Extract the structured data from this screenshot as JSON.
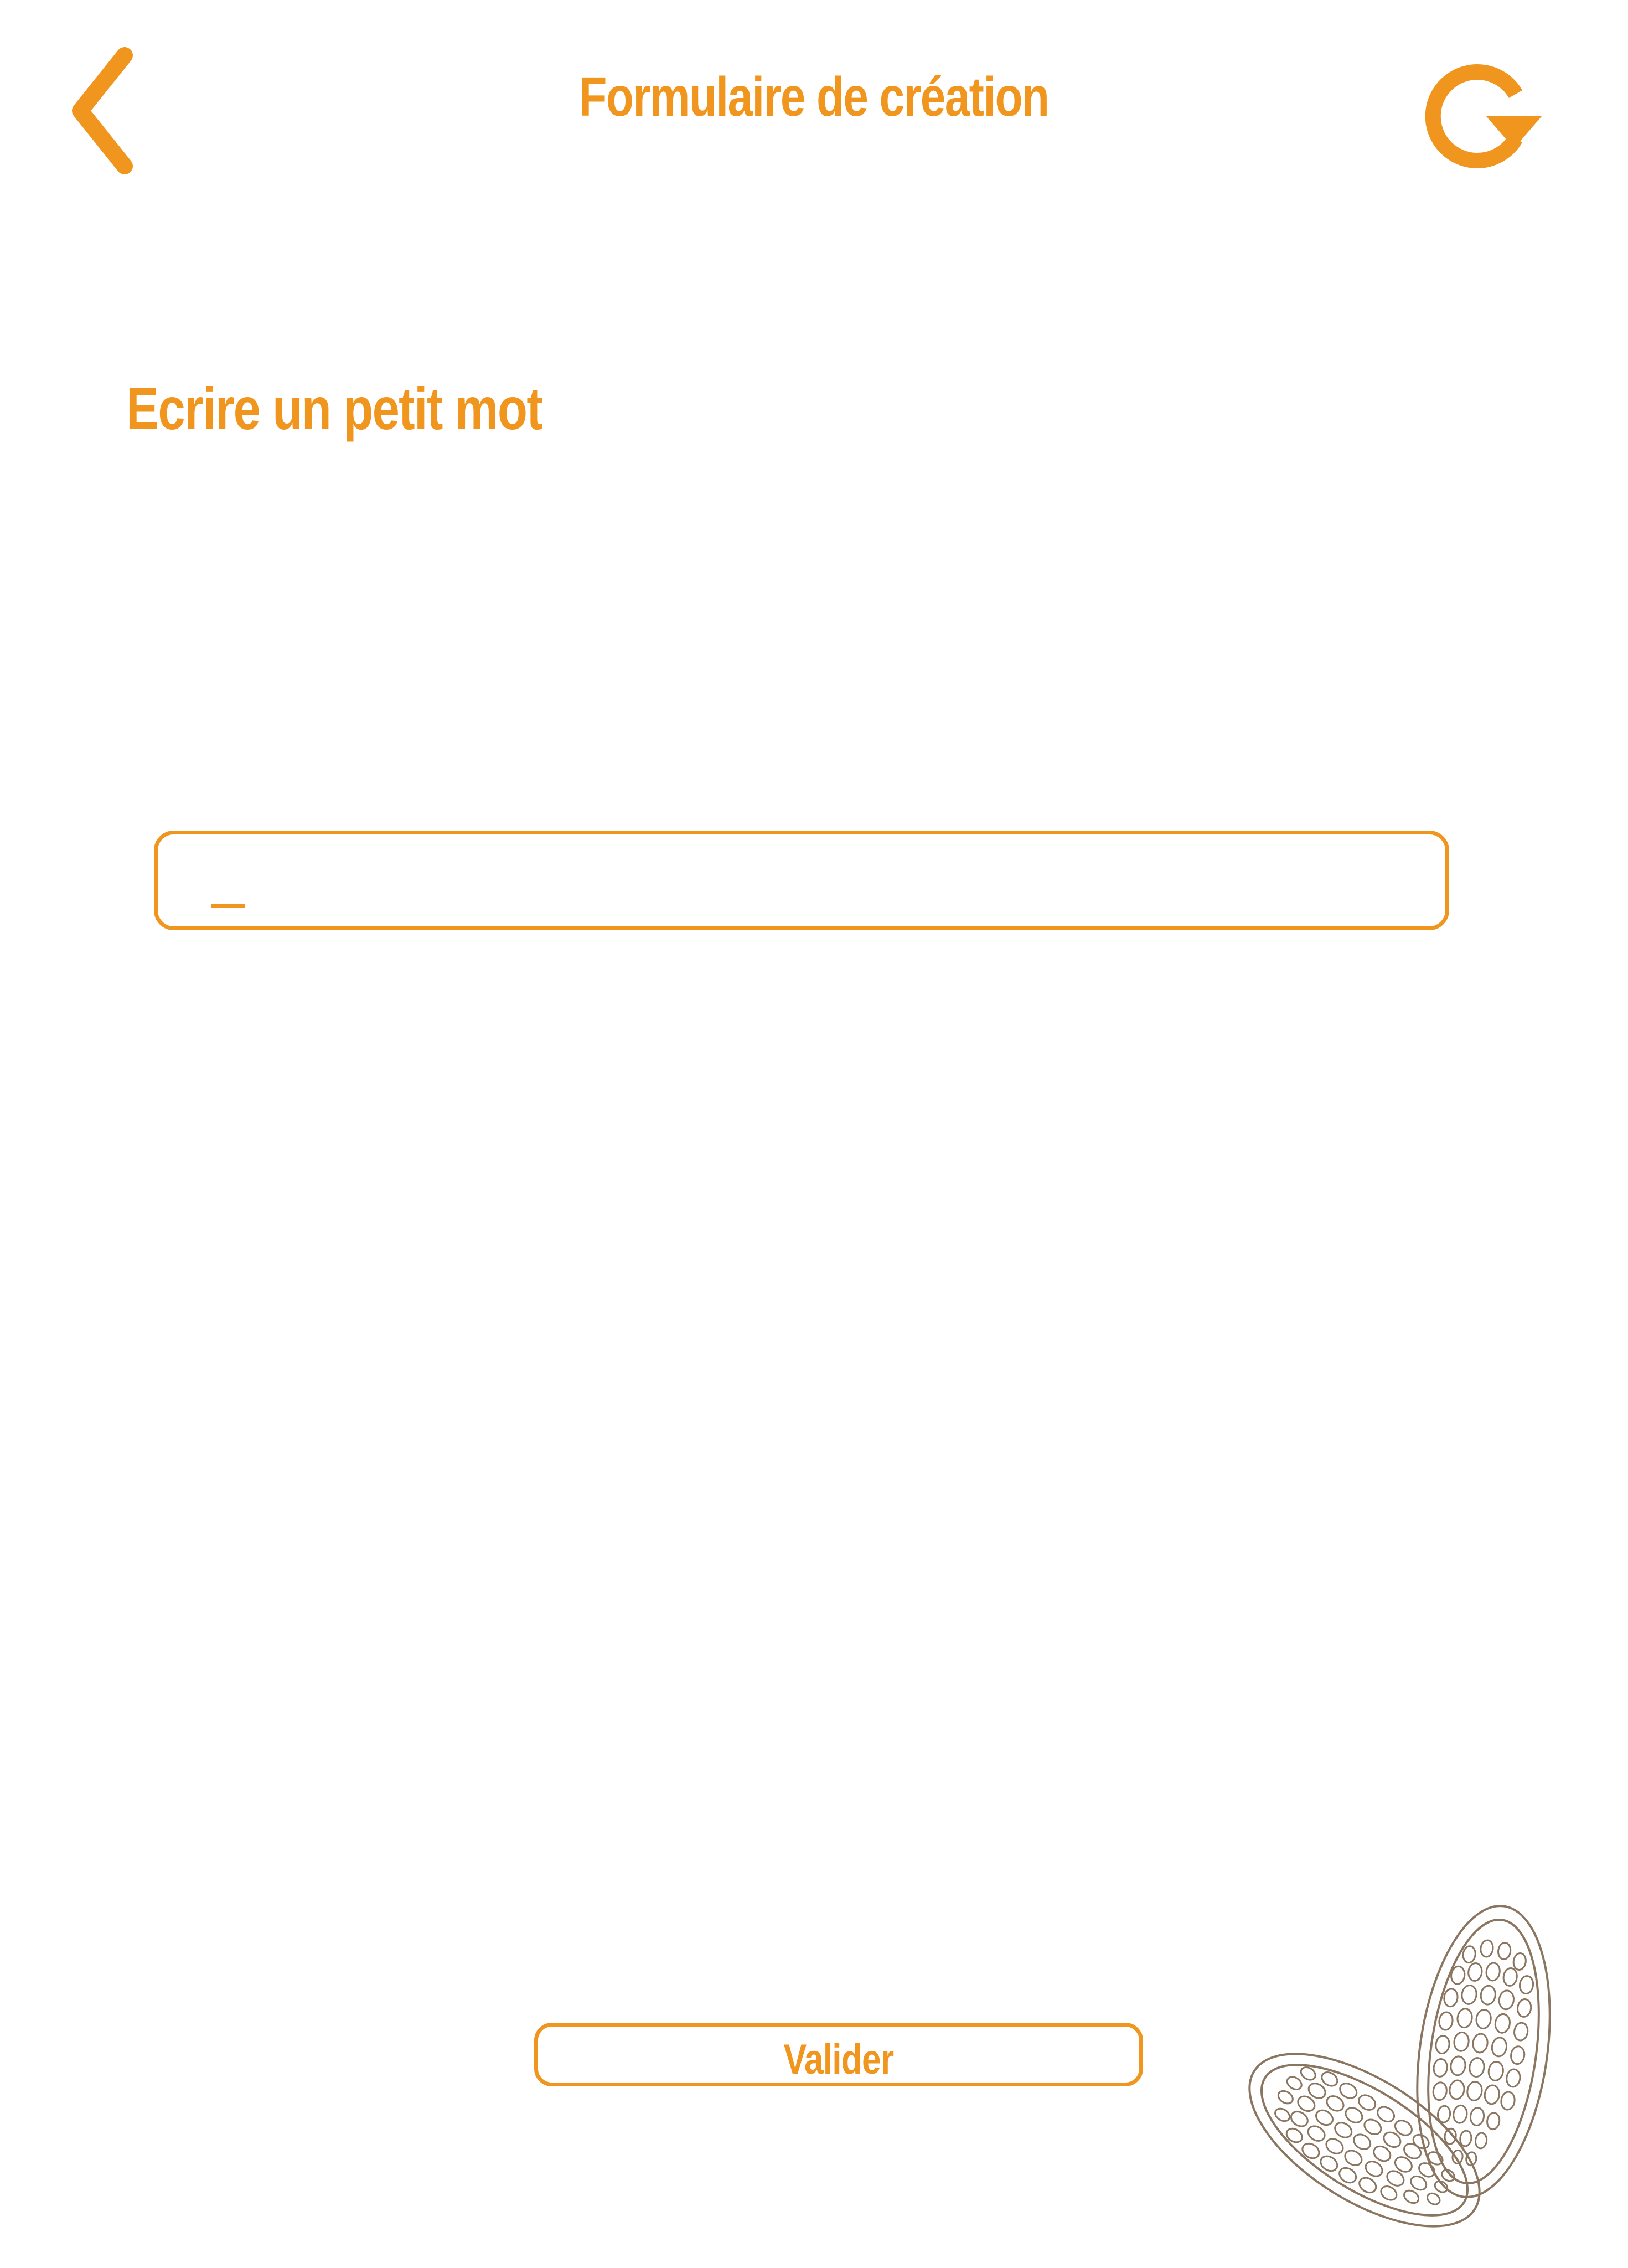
{
  "header": {
    "title": "Formulaire de création",
    "back_icon": "chevron-left-icon",
    "refresh_icon": "refresh-icon"
  },
  "main": {
    "section_title": "Ecrire un petit mot",
    "input": {
      "value": "",
      "placeholder": ""
    },
    "validate_label": "Valider"
  },
  "decoration": {
    "icon": "cocoa-pods-icon"
  },
  "colors": {
    "accent": "#f0961e",
    "decoration_stroke": "#8a7560",
    "background": "#ffffff"
  }
}
